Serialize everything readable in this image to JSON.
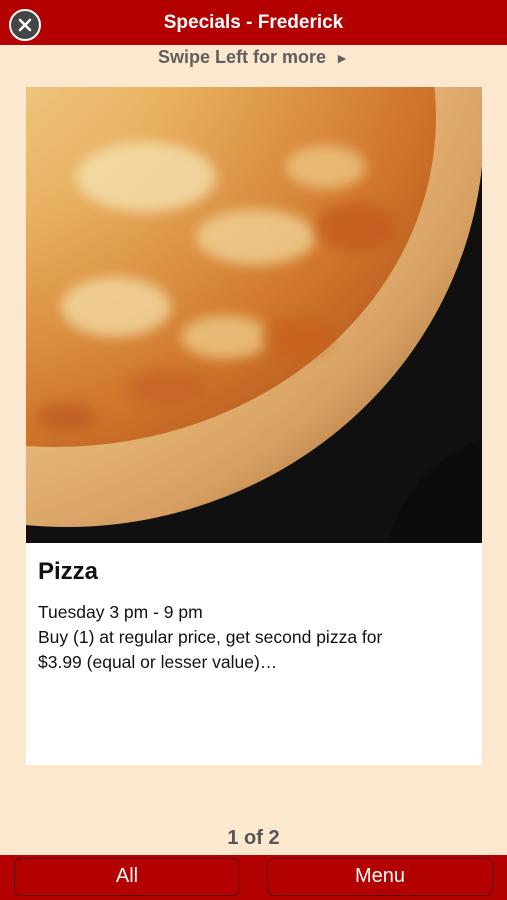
{
  "header": {
    "title": "Specials - Frederick",
    "close_icon": "close-icon",
    "background_color": "#B30000"
  },
  "swipe_hint": {
    "text": "Swipe Left for more",
    "arrow": "►"
  },
  "special": {
    "image_icon": "pizza-photo",
    "title": "Pizza",
    "schedule": "Tuesday 3 pm - 9 pm",
    "description_line1": "Buy (1) at regular price, get second pizza for",
    "description_line2": "$3.99 (equal or lesser value)…"
  },
  "pager": {
    "text": "1 of 2"
  },
  "bottom_bar": {
    "all_label": "All",
    "menu_label": "Menu"
  },
  "colors": {
    "accent": "#B30000",
    "page_background": "#FBE8CE"
  }
}
